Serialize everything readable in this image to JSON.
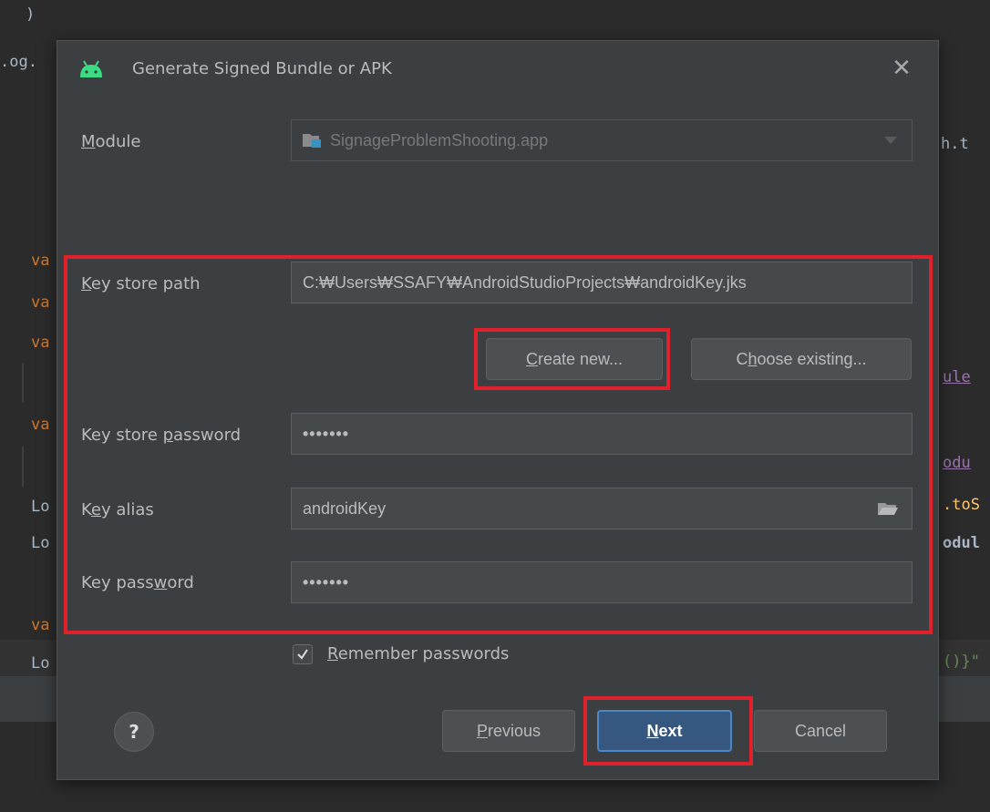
{
  "editor": {
    "lines": [
      {
        "text": ")",
        "kind": "plain"
      },
      {
        "text": ".og.",
        "kind": "plain"
      },
      {
        "text": "h.t",
        "kind": "plain"
      },
      {
        "text": "va",
        "kind": "kw"
      },
      {
        "text": "va",
        "kind": "kw"
      },
      {
        "text": "va",
        "kind": "kw"
      },
      {
        "text": "ule",
        "kind": "link"
      },
      {
        "text": "va",
        "kind": "kw"
      },
      {
        "text": "odu",
        "kind": "link"
      },
      {
        "text": "Lo",
        "kind": "plain"
      },
      {
        "text": ".toS",
        "kind": "fn"
      },
      {
        "text": "Lo",
        "kind": "plain"
      },
      {
        "text": "odul",
        "kind": "plain"
      },
      {
        "text": "va",
        "kind": "kw"
      },
      {
        "text": "Lo",
        "kind": "plain"
      },
      {
        "text": "()}\"",
        "kind": "str"
      }
    ]
  },
  "dialog": {
    "title": "Generate Signed Bundle or APK",
    "close_icon": "close-icon",
    "module": {
      "label_mnemonic": "M",
      "label_rest": "odule",
      "value": "SignageProblemShooting.app"
    },
    "keystore_path": {
      "label_mnemonic": "K",
      "label_rest": "ey store path",
      "value": "C:₩Users₩SSAFY₩AndroidStudioProjects₩androidKey.jks"
    },
    "create_new": {
      "mnemonic": "C",
      "rest": "reate new..."
    },
    "choose_existing": {
      "pre": "C",
      "mnemonic": "h",
      "rest": "oose existing..."
    },
    "keystore_password": {
      "label_pre": "Key store ",
      "label_mnemonic": "p",
      "label_rest": "assword",
      "value": "•••••••"
    },
    "key_alias": {
      "label_pre": "K",
      "label_mnemonic": "e",
      "label_rest": "y alias",
      "value": "androidKey"
    },
    "key_password": {
      "label_pre": "Key pass",
      "label_mnemonic": "w",
      "label_rest": "ord",
      "value": "•••••••"
    },
    "remember": {
      "checked": true,
      "mnemonic": "R",
      "rest": "emember passwords"
    },
    "help": "?",
    "previous": {
      "mnemonic": "P",
      "rest": "revious"
    },
    "next": {
      "mnemonic": "N",
      "rest": "ext"
    },
    "cancel": "Cancel"
  },
  "colors": {
    "accent_button": "#365880",
    "annotation_red": "#e0202a",
    "android_green": "#3ddc84"
  }
}
